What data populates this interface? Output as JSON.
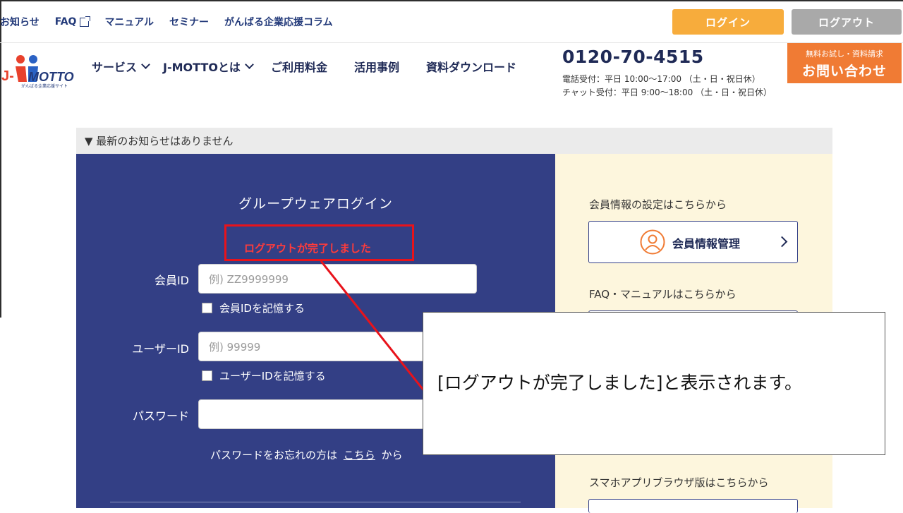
{
  "utility_nav": {
    "news": "お知らせ",
    "faq": "FAQ",
    "manual": "マニュアル",
    "seminar": "セミナー",
    "column": "がんばる企業応援コラム"
  },
  "auth": {
    "login": "ログイン",
    "logout": "ログアウト"
  },
  "logo": {
    "main": "J-MOTTO",
    "tagline": "がんばる企業応援サイト"
  },
  "main_nav": {
    "service": "サービス",
    "about": "J-MOTTOとは",
    "pricing": "ご利用料金",
    "cases": "活用事例",
    "download": "資料ダウンロード"
  },
  "contact": {
    "phone": "0120-70-4515",
    "phone_hours": "電話受付：平日 10:00〜17:00 （土・日・祝日休）",
    "chat_hours": "チャット受付：平日 9:00〜18:00 （土・日・祝日休）",
    "cta_small": "無料お試し・資料請求",
    "cta_big": "お問い合わせ"
  },
  "news_bar": "▼ 最新のお知らせはありません",
  "login_panel": {
    "title": "グループウェアログイン",
    "logout_message": "ログアウトが完了しました",
    "member_id_label": "会員ID",
    "member_id_placeholder": "例) ZZ9999999",
    "remember_member_id": "会員IDを記憶する",
    "user_id_label": "ユーザーID",
    "user_id_placeholder": "例) 99999",
    "remember_user_id": "ユーザーIDを記憶する",
    "password_label": "パスワード",
    "forgot_prefix": "パスワードをお忘れの方は",
    "forgot_link": "こちら",
    "forgot_suffix": "から"
  },
  "side_panel": {
    "member_settings_text": "会員情報の設定はこちらから",
    "member_settings_button": "会員情報管理",
    "faq_text": "FAQ・マニュアルはこちらから",
    "app_text": "スマホアプリブラウザ版はこちらから"
  },
  "annotation": {
    "callout_text": "[ログアウトが完了しました]と表示されます。",
    "frame_color": "#e8131b"
  },
  "colors": {
    "navy": "#333f85",
    "login_button": "#f7ac3c",
    "logout_button": "#a9a9a9",
    "cta": "#f07b34",
    "side_bg": "#fdf6dd"
  }
}
